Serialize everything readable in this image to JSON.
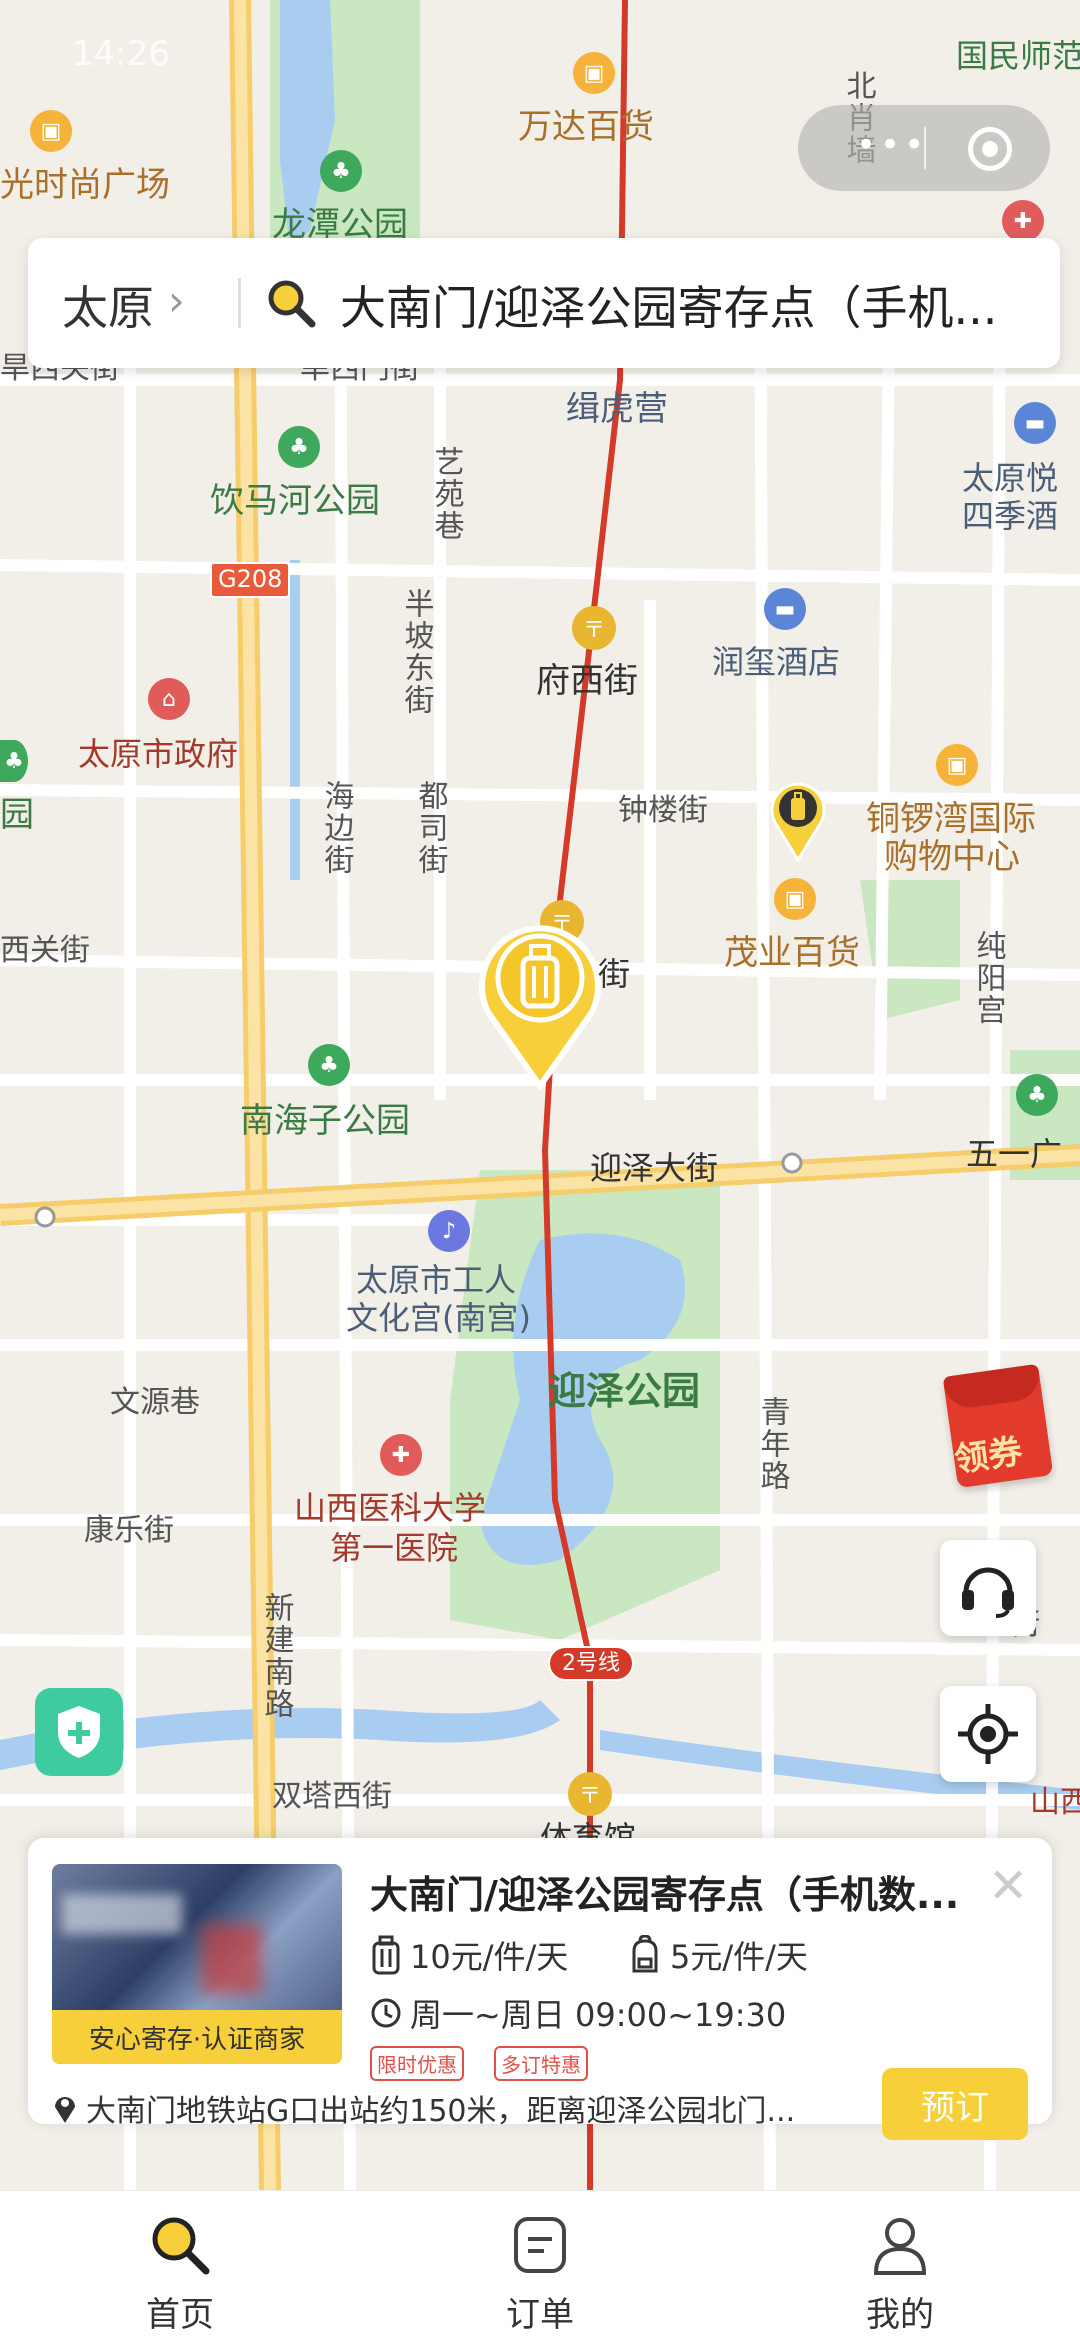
{
  "status_bar": {
    "time": "14:26",
    "right_text": "国民师范"
  },
  "search": {
    "city": "太原",
    "query": "大南门/迎泽公园寄存点（手机..."
  },
  "map": {
    "poi": {
      "wanda": "万达百货",
      "fashion": "光时尚广场",
      "longtan": "龙潭公园",
      "jihuying": "缉虎营",
      "yinmahe": "饮马河公园",
      "taiyuan_yuefu": "太原悦",
      "siji": "四季酒",
      "fuxijie": "府西街",
      "runxi": "润玺酒店",
      "gov": "太原市政府",
      "zhonglou": "钟楼街",
      "tongluowan": "铜锣湾国际",
      "gouwu": "购物中心",
      "maoye": "茂业百货",
      "nanhaizi": "南海子公园",
      "yingze_st": "迎泽大街",
      "wuyi": "五一广",
      "gongren": "太原市工人",
      "wenhua": "文化宫(南宫)",
      "yingze_park": "迎泽公园",
      "yike": "山西医科大学",
      "diyi": "第一医院",
      "line2": "2号线",
      "tiyuguan": "体育馆",
      "shuangta": "双塔西街"
    },
    "streets": {
      "beixiao": "北肖墙",
      "hanxi": "旱西关街",
      "hanximen": "旱西门街",
      "yiyuan": "艺苑巷",
      "banpo": "半坡东街",
      "haibian": "海边街",
      "dusi": "都司街",
      "xiguan": "西关街",
      "cunyang": "纯阳宫",
      "fu_jie": "街",
      "wenyuan": "文源巷",
      "qingnian": "青年路",
      "kangle": "康乐街",
      "xinjian": "新建南路",
      "road_g208": "G208",
      "edge_yuan": "园",
      "edge_jie": "街",
      "edge_shan": "山西"
    }
  },
  "coupon": {
    "label": "领券"
  },
  "card": {
    "title": "大南门/迎泽公园寄存点（手机数...",
    "badge": "安心寄存·认证商家",
    "price_large": "10元/件/天",
    "price_small": "5元/件/天",
    "hours": "周一~周日 09:00~19:30",
    "tags": [
      "限时优惠",
      "多订特惠"
    ],
    "address": "大南门地铁站G口出站约150米，距离迎泽公园北门...",
    "book": "预订"
  },
  "tabs": [
    {
      "label": "首页",
      "icon": "search-icon"
    },
    {
      "label": "订单",
      "icon": "order-icon"
    },
    {
      "label": "我的",
      "icon": "user-icon"
    }
  ],
  "colors": {
    "accent": "#f7cf3a",
    "metro": "#d43a2a",
    "park": "#c9e7c0",
    "water": "#a9cdf0"
  }
}
